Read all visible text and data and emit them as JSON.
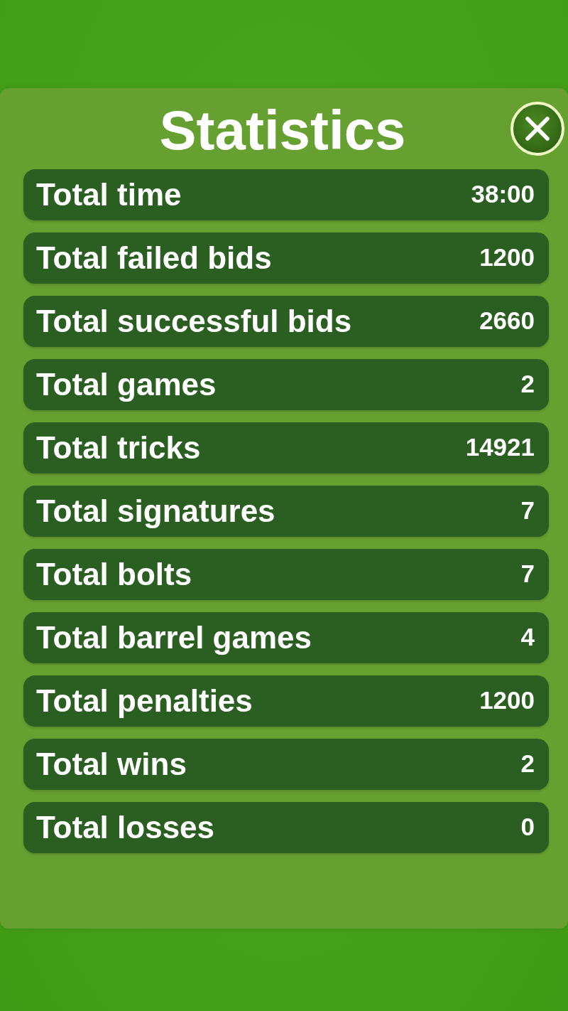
{
  "title": "Statistics",
  "stats": [
    {
      "label": "Total time",
      "value": "38:00"
    },
    {
      "label": "Total failed bids",
      "value": "1200"
    },
    {
      "label": "Total successful bids",
      "value": "2660"
    },
    {
      "label": "Total games",
      "value": "2"
    },
    {
      "label": "Total tricks",
      "value": "14921"
    },
    {
      "label": "Total signatures",
      "value": "7"
    },
    {
      "label": "Total bolts",
      "value": "7"
    },
    {
      "label": "Total barrel games",
      "value": "4"
    },
    {
      "label": "Total penalties",
      "value": "1200"
    },
    {
      "label": "Total wins",
      "value": "2"
    },
    {
      "label": "Total losses",
      "value": "0"
    }
  ]
}
